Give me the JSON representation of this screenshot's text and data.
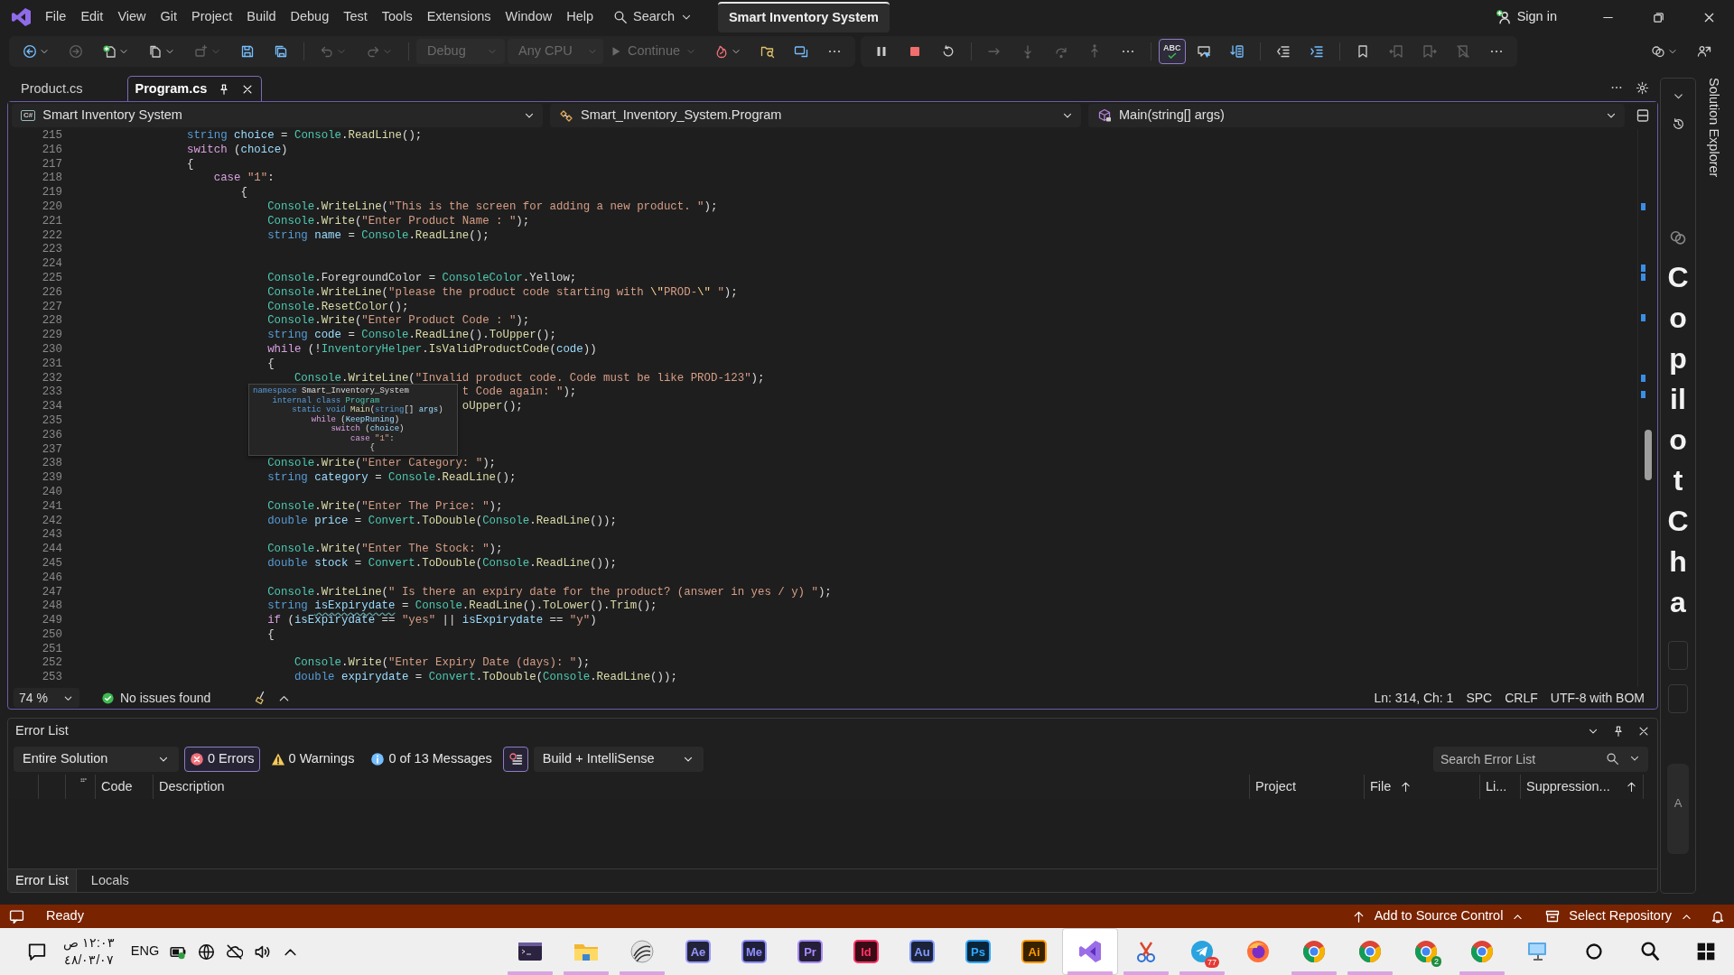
{
  "menu_bar": {
    "items": [
      "File",
      "Edit",
      "View",
      "Git",
      "Project",
      "Build",
      "Debug",
      "Test",
      "Tools",
      "Extensions",
      "Window",
      "Help"
    ],
    "search": "Search",
    "solution_name": "Smart Inventory System",
    "sign_in": "Sign in"
  },
  "toolbar": {
    "groups": [
      {
        "items": [
          {
            "kind": "menu-button",
            "disabled": false
          },
          {
            "kind": "button",
            "disabled": true
          },
          {
            "kind": "menu-button",
            "disabled": false
          },
          {
            "kind": "menu-button",
            "disabled": false
          },
          {
            "kind": "menu-button",
            "disabled": true
          },
          {
            "kind": "button",
            "disabled": false
          },
          {
            "kind": "button",
            "disabled": false
          },
          {
            "kind": "separator"
          },
          {
            "kind": "menu-button",
            "disabled": true
          },
          {
            "kind": "menu-button",
            "disabled": true
          },
          {
            "kind": "separator"
          },
          {
            "kind": "dropdown",
            "label": "Debug",
            "disabled": true
          },
          {
            "kind": "dropdown",
            "label": "Any CPU",
            "disabled": true
          },
          {
            "kind": "run",
            "label": "Continue",
            "disabled": true
          },
          {
            "kind": "menu-button",
            "disabled": false
          },
          {
            "kind": "button",
            "disabled": false
          },
          {
            "kind": "button",
            "disabled": false
          },
          {
            "kind": "button",
            "disabled": false
          }
        ]
      },
      {
        "items": [
          {
            "kind": "button",
            "disabled": false
          },
          {
            "kind": "button",
            "disabled": false
          },
          {
            "kind": "button",
            "disabled": false
          },
          {
            "kind": "separator"
          },
          {
            "kind": "button",
            "disabled": true
          },
          {
            "kind": "button",
            "disabled": true
          },
          {
            "kind": "button",
            "disabled": true
          },
          {
            "kind": "button",
            "disabled": true
          },
          {
            "kind": "button",
            "disabled": false
          },
          {
            "kind": "separator"
          },
          {
            "kind": "toggle",
            "label": "ABC",
            "on": true
          },
          {
            "kind": "button",
            "disabled": false
          },
          {
            "kind": "button",
            "disabled": false
          },
          {
            "kind": "separator"
          },
          {
            "kind": "button",
            "disabled": false
          },
          {
            "kind": "button",
            "disabled": false
          },
          {
            "kind": "separator"
          },
          {
            "kind": "button",
            "disabled": false
          },
          {
            "kind": "button",
            "disabled": true
          },
          {
            "kind": "button",
            "disabled": true
          },
          {
            "kind": "button",
            "disabled": true
          },
          {
            "kind": "button",
            "disabled": false
          }
        ]
      },
      {
        "items": [
          {
            "kind": "menu-button",
            "disabled": false
          },
          {
            "kind": "button",
            "disabled": false
          }
        ]
      }
    ]
  },
  "document_tabs": [
    {
      "label": "Product.cs",
      "selected": false
    },
    {
      "label": "Program.cs",
      "selected": true
    }
  ],
  "navigation": {
    "project_icon": "C#",
    "project": "Smart Inventory System",
    "type": "Smart_Inventory_System.Program",
    "member": "Main(string[] args)"
  },
  "editor": {
    "lines": [
      {
        "number": "215",
        "tokens": [
          {
            "kind": "keyword",
            "text": "                string "
          },
          {
            "kind": "variable",
            "text": "choice"
          },
          {
            "kind": "plain",
            "text": " = "
          },
          {
            "kind": "type",
            "text": "Console"
          },
          {
            "kind": "plain",
            "text": "."
          },
          {
            "kind": "method",
            "text": "ReadLine"
          },
          {
            "kind": "plain",
            "text": "();"
          }
        ]
      },
      {
        "number": "216",
        "tokens": [
          {
            "kind": "control",
            "text": "                switch"
          },
          {
            "kind": "plain",
            "text": " ("
          },
          {
            "kind": "variable",
            "text": "choice"
          },
          {
            "kind": "plain",
            "text": ")"
          }
        ]
      },
      {
        "number": "217",
        "tokens": [
          {
            "kind": "plain",
            "text": "                {"
          }
        ]
      },
      {
        "number": "218",
        "tokens": [
          {
            "kind": "control",
            "text": "                    case "
          },
          {
            "kind": "string",
            "text": "\"1\""
          },
          {
            "kind": "plain",
            "text": ":"
          }
        ]
      },
      {
        "number": "219",
        "tokens": [
          {
            "kind": "plain",
            "text": "                        {"
          }
        ]
      },
      {
        "number": "220",
        "tokens": [
          {
            "kind": "type",
            "text": "                            Console"
          },
          {
            "kind": "plain",
            "text": "."
          },
          {
            "kind": "method",
            "text": "WriteLine"
          },
          {
            "kind": "plain",
            "text": "("
          },
          {
            "kind": "string",
            "text": "\"This is the screen for adding a new product. \""
          },
          {
            "kind": "plain",
            "text": ");"
          }
        ]
      },
      {
        "number": "221",
        "tokens": [
          {
            "kind": "type",
            "text": "                            Console"
          },
          {
            "kind": "plain",
            "text": "."
          },
          {
            "kind": "method",
            "text": "Write"
          },
          {
            "kind": "plain",
            "text": "("
          },
          {
            "kind": "string",
            "text": "\"Enter Product Name : \""
          },
          {
            "kind": "plain",
            "text": ");"
          }
        ]
      },
      {
        "number": "222",
        "tokens": [
          {
            "kind": "keyword",
            "text": "                            string "
          },
          {
            "kind": "variable",
            "text": "name"
          },
          {
            "kind": "plain",
            "text": " = "
          },
          {
            "kind": "type",
            "text": "Console"
          },
          {
            "kind": "plain",
            "text": "."
          },
          {
            "kind": "method",
            "text": "ReadLine"
          },
          {
            "kind": "plain",
            "text": "();"
          }
        ]
      },
      {
        "number": "223"
      },
      {
        "number": "224"
      },
      {
        "number": "225",
        "tokens": [
          {
            "kind": "type",
            "text": "                            Console"
          },
          {
            "kind": "plain",
            "text": ".ForegroundColor = "
          },
          {
            "kind": "type",
            "text": "ConsoleColor"
          },
          {
            "kind": "plain",
            "text": ".Yellow;"
          }
        ]
      },
      {
        "number": "226",
        "tokens": [
          {
            "kind": "type",
            "text": "                            Console"
          },
          {
            "kind": "plain",
            "text": "."
          },
          {
            "kind": "method",
            "text": "WriteLine"
          },
          {
            "kind": "plain",
            "text": "("
          },
          {
            "kind": "string",
            "text": "\"please the product code starting with "
          },
          {
            "kind": "escape",
            "text": "\\\""
          },
          {
            "kind": "string",
            "text": "PROD-"
          },
          {
            "kind": "escape",
            "text": "\\\""
          },
          {
            "kind": "string",
            "text": " \""
          },
          {
            "kind": "plain",
            "text": ");"
          }
        ]
      },
      {
        "number": "227",
        "tokens": [
          {
            "kind": "type",
            "text": "                            Console"
          },
          {
            "kind": "plain",
            "text": "."
          },
          {
            "kind": "method",
            "text": "ResetColor"
          },
          {
            "kind": "plain",
            "text": "();"
          }
        ]
      },
      {
        "number": "228",
        "tokens": [
          {
            "kind": "type",
            "text": "                            Console"
          },
          {
            "kind": "plain",
            "text": "."
          },
          {
            "kind": "method",
            "text": "Write"
          },
          {
            "kind": "plain",
            "text": "("
          },
          {
            "kind": "string",
            "text": "\"Enter Product Code : \""
          },
          {
            "kind": "plain",
            "text": ");"
          }
        ]
      },
      {
        "number": "229",
        "tokens": [
          {
            "kind": "keyword",
            "text": "                            string "
          },
          {
            "kind": "variable",
            "text": "code"
          },
          {
            "kind": "plain",
            "text": " = "
          },
          {
            "kind": "type",
            "text": "Console"
          },
          {
            "kind": "plain",
            "text": "."
          },
          {
            "kind": "method",
            "text": "ReadLine"
          },
          {
            "kind": "plain",
            "text": "()."
          },
          {
            "kind": "method",
            "text": "ToUpper"
          },
          {
            "kind": "plain",
            "text": "();"
          }
        ]
      },
      {
        "number": "230",
        "tokens": [
          {
            "kind": "control",
            "text": "                            while"
          },
          {
            "kind": "plain",
            "text": " (!"
          },
          {
            "kind": "type",
            "text": "InventoryHelper"
          },
          {
            "kind": "plain",
            "text": "."
          },
          {
            "kind": "method",
            "text": "IsValidProductCode"
          },
          {
            "kind": "plain",
            "text": "("
          },
          {
            "kind": "variable",
            "text": "code"
          },
          {
            "kind": "plain",
            "text": "))"
          }
        ]
      },
      {
        "number": "231",
        "tokens": [
          {
            "kind": "plain",
            "text": "                            {"
          }
        ]
      },
      {
        "number": "232",
        "tokens": [
          {
            "kind": "type",
            "text": "                                Console"
          },
          {
            "kind": "plain",
            "text": "."
          },
          {
            "kind": "method",
            "text": "WriteLine"
          },
          {
            "kind": "plain",
            "text": "("
          },
          {
            "kind": "string",
            "text": "\"Invalid product code. Code must be like PROD-123\""
          },
          {
            "kind": "plain",
            "text": ");"
          }
        ]
      },
      {
        "number": "233",
        "tokens": [
          {
            "kind": "string",
            "text": "                                                         t Code again: \""
          },
          {
            "kind": "plain",
            "text": ");"
          }
        ]
      },
      {
        "number": "234",
        "tokens": [
          {
            "kind": "method",
            "text": "                                                         oUpper"
          },
          {
            "kind": "plain",
            "text": "();"
          }
        ]
      },
      {
        "number": "235"
      },
      {
        "number": "236"
      },
      {
        "number": "237"
      },
      {
        "number": "238",
        "tokens": [
          {
            "kind": "type",
            "text": "                            Console"
          },
          {
            "kind": "plain",
            "text": "."
          },
          {
            "kind": "method",
            "text": "Write"
          },
          {
            "kind": "plain",
            "text": "("
          },
          {
            "kind": "string",
            "text": "\"Enter Category: \""
          },
          {
            "kind": "plain",
            "text": ");"
          }
        ]
      },
      {
        "number": "239",
        "tokens": [
          {
            "kind": "keyword",
            "text": "                            string "
          },
          {
            "kind": "variable",
            "text": "category"
          },
          {
            "kind": "plain",
            "text": " = "
          },
          {
            "kind": "type",
            "text": "Console"
          },
          {
            "kind": "plain",
            "text": "."
          },
          {
            "kind": "method",
            "text": "ReadLine"
          },
          {
            "kind": "plain",
            "text": "();"
          }
        ]
      },
      {
        "number": "240"
      },
      {
        "number": "241",
        "tokens": [
          {
            "kind": "type",
            "text": "                            Console"
          },
          {
            "kind": "plain",
            "text": "."
          },
          {
            "kind": "method",
            "text": "Write"
          },
          {
            "kind": "plain",
            "text": "("
          },
          {
            "kind": "string",
            "text": "\"Enter The Price: \""
          },
          {
            "kind": "plain",
            "text": ");"
          }
        ]
      },
      {
        "number": "242",
        "tokens": [
          {
            "kind": "keyword",
            "text": "                            double "
          },
          {
            "kind": "variable",
            "text": "price"
          },
          {
            "kind": "plain",
            "text": " = "
          },
          {
            "kind": "type",
            "text": "Convert"
          },
          {
            "kind": "plain",
            "text": "."
          },
          {
            "kind": "method",
            "text": "ToDouble"
          },
          {
            "kind": "plain",
            "text": "("
          },
          {
            "kind": "type",
            "text": "Console"
          },
          {
            "kind": "plain",
            "text": "."
          },
          {
            "kind": "method",
            "text": "ReadLine"
          },
          {
            "kind": "plain",
            "text": "());"
          }
        ]
      },
      {
        "number": "243"
      },
      {
        "number": "244",
        "tokens": [
          {
            "kind": "type",
            "text": "                            Console"
          },
          {
            "kind": "plain",
            "text": "."
          },
          {
            "kind": "method",
            "text": "Write"
          },
          {
            "kind": "plain",
            "text": "("
          },
          {
            "kind": "string",
            "text": "\"Enter The Stock: \""
          },
          {
            "kind": "plain",
            "text": ");"
          }
        ]
      },
      {
        "number": "245",
        "tokens": [
          {
            "kind": "keyword",
            "text": "                            double "
          },
          {
            "kind": "variable",
            "text": "stock"
          },
          {
            "kind": "plain",
            "text": " = "
          },
          {
            "kind": "type",
            "text": "Convert"
          },
          {
            "kind": "plain",
            "text": "."
          },
          {
            "kind": "method",
            "text": "ToDouble"
          },
          {
            "kind": "plain",
            "text": "("
          },
          {
            "kind": "type",
            "text": "Console"
          },
          {
            "kind": "plain",
            "text": "."
          },
          {
            "kind": "method",
            "text": "ReadLine"
          },
          {
            "kind": "plain",
            "text": "());"
          }
        ]
      },
      {
        "number": "246"
      },
      {
        "number": "247",
        "tokens": [
          {
            "kind": "type",
            "text": "                            Console"
          },
          {
            "kind": "plain",
            "text": "."
          },
          {
            "kind": "method",
            "text": "WriteLine"
          },
          {
            "kind": "plain",
            "text": "("
          },
          {
            "kind": "string",
            "text": "\" Is there an expiry date for the product? (answer in yes / y) \""
          },
          {
            "kind": "plain",
            "text": ");"
          }
        ]
      },
      {
        "number": "248",
        "tokens": [
          {
            "kind": "keyword",
            "text": "                            string "
          },
          {
            "kind": "squiggle",
            "text": "isExpirydate"
          },
          {
            "kind": "plain",
            "text": " = "
          },
          {
            "kind": "type",
            "text": "Console"
          },
          {
            "kind": "plain",
            "text": "."
          },
          {
            "kind": "method",
            "text": "ReadLine"
          },
          {
            "kind": "plain",
            "text": "()."
          },
          {
            "kind": "method",
            "text": "ToLower"
          },
          {
            "kind": "plain",
            "text": "()."
          },
          {
            "kind": "method",
            "text": "Trim"
          },
          {
            "kind": "plain",
            "text": "();"
          }
        ]
      },
      {
        "number": "249",
        "tokens": [
          {
            "kind": "control",
            "text": "                            if"
          },
          {
            "kind": "plain",
            "text": " ("
          },
          {
            "kind": "variable",
            "text": "isExpirydate"
          },
          {
            "kind": "plain",
            "text": " == "
          },
          {
            "kind": "string",
            "text": "\"yes\""
          },
          {
            "kind": "plain",
            "text": " || "
          },
          {
            "kind": "variable",
            "text": "isExpirydate"
          },
          {
            "kind": "plain",
            "text": " == "
          },
          {
            "kind": "string",
            "text": "\"y\""
          },
          {
            "kind": "plain",
            "text": ")"
          }
        ]
      },
      {
        "number": "250",
        "tokens": [
          {
            "kind": "plain",
            "text": "                            {"
          }
        ]
      },
      {
        "number": "251"
      },
      {
        "number": "252",
        "tokens": [
          {
            "kind": "type",
            "text": "                                Console"
          },
          {
            "kind": "plain",
            "text": "."
          },
          {
            "kind": "method",
            "text": "Write"
          },
          {
            "kind": "plain",
            "text": "("
          },
          {
            "kind": "string",
            "text": "\"Enter Expiry Date (days): \""
          },
          {
            "kind": "plain",
            "text": ");"
          }
        ]
      },
      {
        "number": "253",
        "tokens": [
          {
            "kind": "keyword",
            "text": "                                double "
          },
          {
            "kind": "variable",
            "text": "expirydate"
          },
          {
            "kind": "plain",
            "text": " = "
          },
          {
            "kind": "type",
            "text": "Convert"
          },
          {
            "kind": "plain",
            "text": "."
          },
          {
            "kind": "method",
            "text": "ToDouble"
          },
          {
            "kind": "plain",
            "text": "("
          },
          {
            "kind": "type",
            "text": "Console"
          },
          {
            "kind": "plain",
            "text": "."
          },
          {
            "kind": "method",
            "text": "ReadLine"
          },
          {
            "kind": "plain",
            "text": "());"
          }
        ]
      }
    ],
    "sticky_scroll": [
      {
        "tokens": [
          {
            "kind": "keyword",
            "text": "namespace"
          },
          {
            "kind": "plain",
            "text": " Smart_Inventory_System"
          }
        ]
      },
      {
        "tokens": [
          {
            "kind": "keyword",
            "text": "    internal class "
          },
          {
            "kind": "type",
            "text": "Program"
          }
        ]
      },
      {
        "tokens": [
          {
            "kind": "keyword",
            "text": "        static void "
          },
          {
            "kind": "method",
            "text": "Main"
          },
          {
            "kind": "plain",
            "text": "("
          },
          {
            "kind": "keyword",
            "text": "string"
          },
          {
            "kind": "plain",
            "text": "[] "
          },
          {
            "kind": "variable",
            "text": "args"
          },
          {
            "kind": "plain",
            "text": ")"
          }
        ]
      },
      {
        "tokens": [
          {
            "kind": "control",
            "text": "            while"
          },
          {
            "kind": "plain",
            "text": " ("
          },
          {
            "kind": "variable",
            "text": "KeepRuning"
          },
          {
            "kind": "plain",
            "text": ")"
          }
        ]
      },
      {
        "tokens": [
          {
            "kind": "control",
            "text": "                switch"
          },
          {
            "kind": "plain",
            "text": " ("
          },
          {
            "kind": "variable",
            "text": "choice"
          },
          {
            "kind": "plain",
            "text": ")"
          }
        ]
      },
      {
        "tokens": [
          {
            "kind": "control",
            "text": "                    case "
          },
          {
            "kind": "string",
            "text": "\"1\""
          },
          {
            "kind": "plain",
            "text": ":"
          }
        ]
      },
      {
        "tokens": [
          {
            "kind": "plain",
            "text": "                        {"
          }
        ]
      }
    ]
  },
  "editor_status": {
    "zoom": "74 %",
    "issues": "No issues found",
    "position": "Ln: 314, Ch: 1",
    "indentation": "SPC",
    "line_endings": "CRLF",
    "encoding": "UTF-8 with BOM"
  },
  "side_panel": {
    "copilot_chat": "CopilotCha",
    "cut_label": "A",
    "solution_explorer": "Solution Explorer"
  },
  "error_list": {
    "title": "Error List",
    "scope": "Entire Solution",
    "filters": [
      {
        "kind": "error",
        "label": "0 Errors",
        "on": true
      },
      {
        "kind": "warning",
        "label": "0 Warnings",
        "on": false
      },
      {
        "kind": "info",
        "label": "0 of 13 Messages",
        "on": false
      },
      {
        "kind": "custom",
        "on": true
      }
    ],
    "source": "Build + IntelliSense",
    "search": {
      "placeholder": "Search Error List"
    },
    "columns": [
      {
        "kind": "blank"
      },
      {
        "kind": "blank"
      },
      {
        "kind": "icon"
      },
      {
        "kind": "text",
        "label": "Code",
        "sorted": false
      },
      {
        "kind": "text",
        "label": "Description",
        "sorted": false
      },
      {
        "kind": "text",
        "label": "Project",
        "sorted": false
      },
      {
        "kind": "text",
        "label": "File",
        "sorted": true
      },
      {
        "kind": "text",
        "label": "Li...",
        "sorted": false
      },
      {
        "kind": "text",
        "label": "Suppression...",
        "sorted": true
      }
    ],
    "tabs": [
      {
        "label": "Error List",
        "selected": true
      },
      {
        "label": "Locals",
        "selected": false
      }
    ]
  },
  "status_bar": {
    "state": "Ready",
    "source_control": "Add to Source Control",
    "repository": "Select Repository"
  },
  "taskbar": {
    "time": "١٢:٠٣ ص",
    "date": "٤٨/٠٣/٠٧",
    "language": "ENG",
    "apps": [
      {
        "kind": "terminal",
        "running": true,
        "selected": false
      },
      {
        "kind": "folder",
        "running": true,
        "selected": false
      },
      {
        "kind": "wave",
        "running": true,
        "selected": false
      },
      {
        "kind": "adobe",
        "label": "Ae",
        "color": "#9999ff",
        "running": false,
        "selected": false
      },
      {
        "kind": "adobe",
        "label": "Me",
        "color": "#8f8fff",
        "running": false,
        "selected": false
      },
      {
        "kind": "adobe",
        "label": "Pr",
        "color": "#a78bfa",
        "running": false,
        "selected": false
      },
      {
        "kind": "adobe",
        "label": "Id",
        "color": "#ff3366",
        "running": false,
        "selected": false
      },
      {
        "kind": "adobe",
        "label": "Au",
        "color": "#7f9cff",
        "running": false,
        "selected": false
      },
      {
        "kind": "adobe",
        "label": "Ps",
        "color": "#31a8ff",
        "running": false,
        "selected": false
      },
      {
        "kind": "adobe",
        "label": "Ai",
        "color": "#ff9a00",
        "running": false,
        "selected": false
      },
      {
        "kind": "studio",
        "running": true,
        "selected": true
      },
      {
        "kind": "snip",
        "running": true,
        "selected": false
      },
      {
        "kind": "telegram",
        "badge": "77",
        "running": true,
        "selected": false
      },
      {
        "kind": "firefox",
        "running": false,
        "selected": false
      },
      {
        "kind": "chrome",
        "running": true,
        "selected": false
      },
      {
        "kind": "chrome",
        "running": true,
        "selected": false
      },
      {
        "kind": "chrome",
        "badge": "2",
        "running": false,
        "selected": false
      },
      {
        "kind": "chrome",
        "running": true,
        "selected": false
      },
      {
        "kind": "remote",
        "running": false,
        "selected": false
      }
    ]
  }
}
